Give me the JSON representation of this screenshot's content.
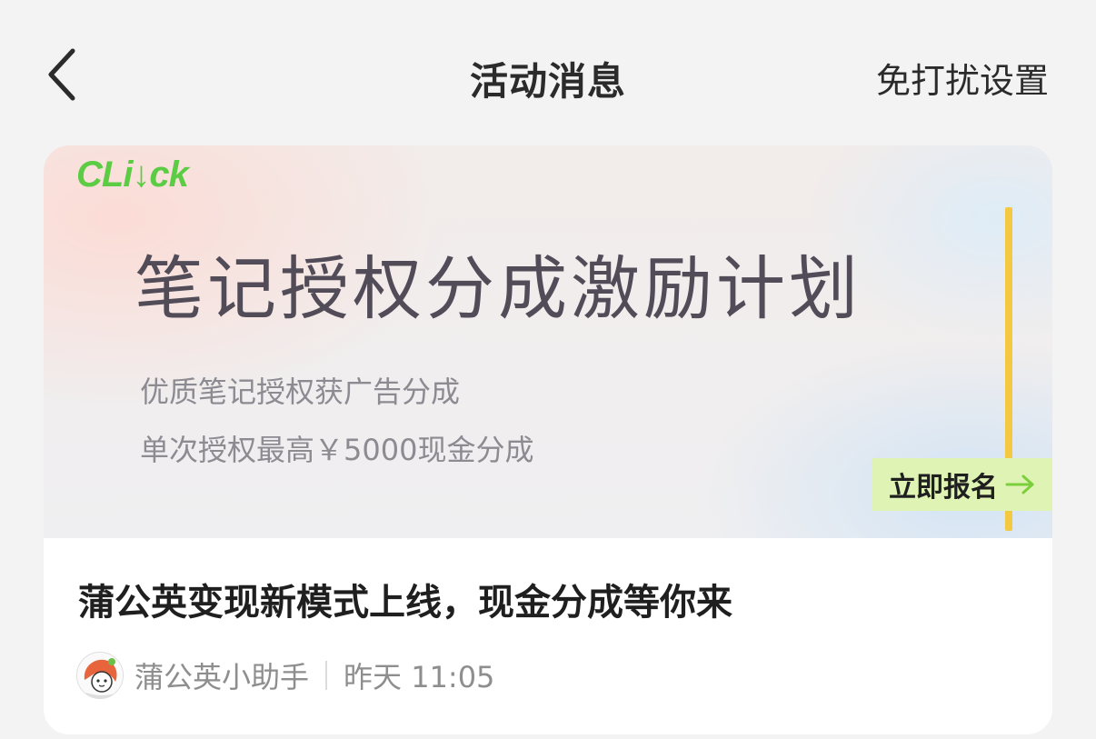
{
  "header": {
    "title": "活动消息",
    "dnd_label": "免打扰设置",
    "back_icon": "chevron-left-icon"
  },
  "message": {
    "banner": {
      "logo": "CLi↓ck",
      "title": "笔记授权分成激励计划",
      "subtitle_line1": "优质笔记授权获广告分成",
      "subtitle_line2": "单次授权最高￥5000现金分成",
      "cta_label": "立即报名",
      "cta_icon": "arrow-right-icon",
      "logo_color": "#5bcc43",
      "accent_yellow": "#f5c842",
      "cta_bg": "#dff4b4"
    },
    "title": "蒲公英变现新模式上线，现金分成等你来",
    "author": "蒲公英小助手",
    "time": "昨天 11:05"
  }
}
